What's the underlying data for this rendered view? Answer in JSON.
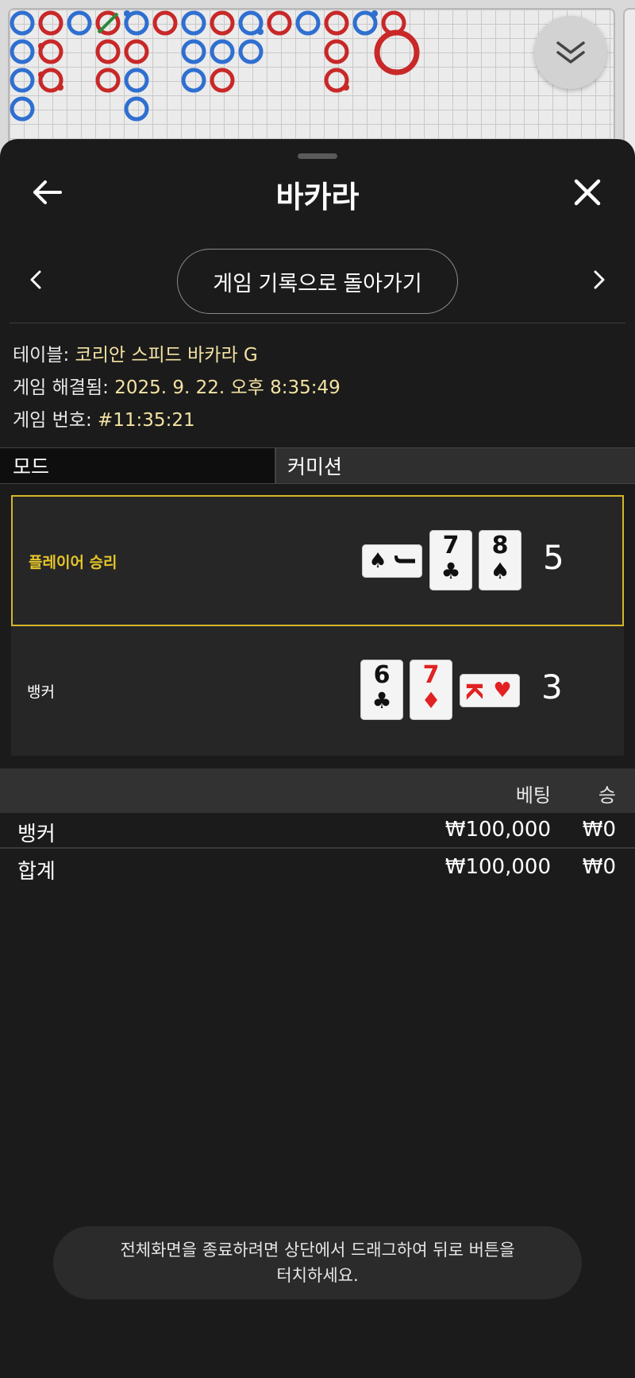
{
  "header": {
    "title": "바카라"
  },
  "nav": {
    "return_label": "게임 기록으로 돌아가기"
  },
  "info": {
    "table_label": "테이블:",
    "table_value": "코리안 스피드 바카라 G",
    "resolved_label": "게임 해결됨:",
    "resolved_value": "2025. 9. 22. 오후 8:35:49",
    "number_label": "게임 번호:",
    "number_value": "#11:35:21"
  },
  "mode": {
    "left": "모드",
    "right": "커미션"
  },
  "results": {
    "player": {
      "label": "플레이어 승리",
      "score": "5",
      "cards": [
        {
          "rank": "J",
          "suit": "♠",
          "color": "black",
          "orientation": "sideways"
        },
        {
          "rank": "7",
          "suit": "♣",
          "color": "black",
          "orientation": "upright"
        },
        {
          "rank": "8",
          "suit": "♠",
          "color": "black",
          "orientation": "upright"
        }
      ]
    },
    "banker": {
      "label": "뱅커",
      "score": "3",
      "cards": [
        {
          "rank": "6",
          "suit": "♣",
          "color": "black",
          "orientation": "upright"
        },
        {
          "rank": "7",
          "suit": "♦",
          "color": "red",
          "orientation": "upright"
        },
        {
          "rank": "K",
          "suit": "♥",
          "color": "red",
          "orientation": "sideways"
        }
      ]
    }
  },
  "bets": {
    "col_bet": "베팅",
    "col_win": "승",
    "rows": [
      {
        "name": "뱅커",
        "bet": "₩100,000",
        "win": "₩0"
      },
      {
        "name": "합계",
        "bet": "₩100,000",
        "win": "₩0"
      }
    ]
  },
  "toast": {
    "line1": "전체화면을 종료하려면 상단에서 드래그하여 뒤로 버튼을",
    "line2": "터치하세요."
  },
  "colors": {
    "accent": "#d4b62a",
    "player_blue": "#2f6fd0",
    "banker_red": "#c82828"
  },
  "icons": [
    "back-arrow-icon",
    "close-icon",
    "chevron-left-icon",
    "chevron-right-icon",
    "double-chevron-down-icon"
  ]
}
